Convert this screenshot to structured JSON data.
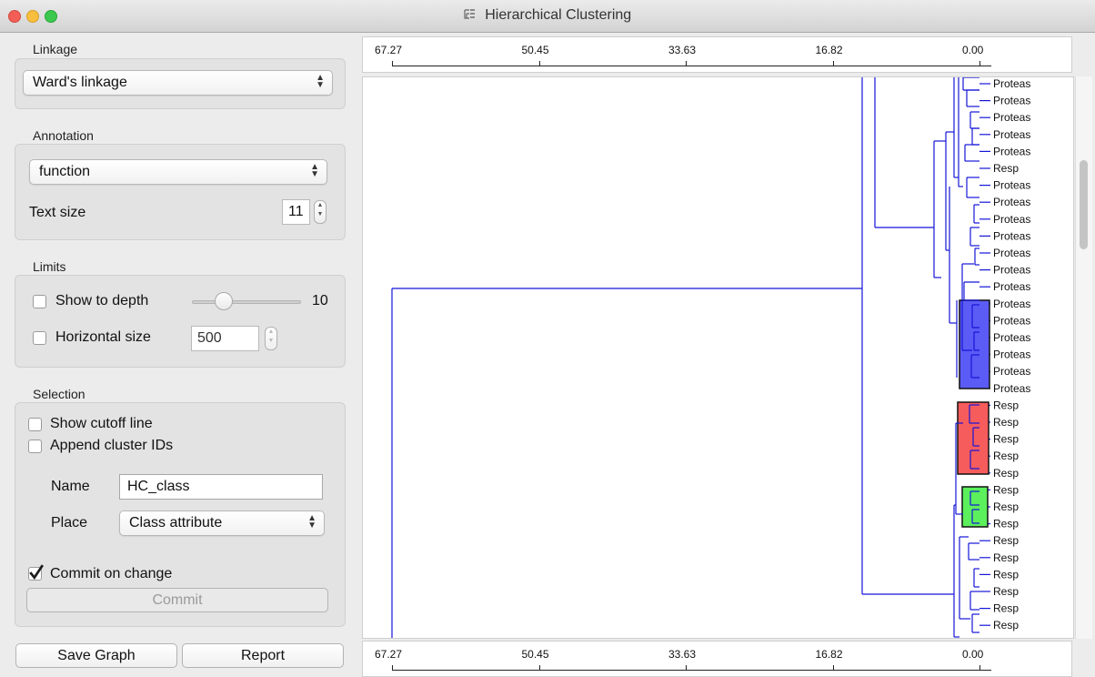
{
  "window": {
    "title": "Hierarchical Clustering"
  },
  "linkage": {
    "title": "Linkage",
    "value": "Ward's linkage"
  },
  "annotation": {
    "title": "Annotation",
    "value": "function",
    "text_size_label": "Text size",
    "text_size_value": "11"
  },
  "limits": {
    "title": "Limits",
    "show_depth_label": "Show to depth",
    "depth_value": "10",
    "depth_fraction": 0.25,
    "horizontal_size_label": "Horizontal size",
    "horizontal_size_value": "500"
  },
  "selection": {
    "title": "Selection",
    "show_cutoff_label": "Show cutoff line",
    "append_ids_label": "Append cluster IDs",
    "name_label": "Name",
    "name_value": "HC_class",
    "place_label": "Place",
    "place_value": "Class attribute",
    "commit_on_change_label": "Commit on change",
    "commit_on_change_checked": true,
    "commit_button": "Commit"
  },
  "footer": {
    "save_graph": "Save Graph",
    "report": "Report"
  },
  "axis": {
    "ticks": [
      "67.27",
      "50.45",
      "33.63",
      "16.82",
      "0.00"
    ]
  },
  "leaves": [
    "Proteas",
    "Proteas",
    "Proteas",
    "Proteas",
    "Proteas",
    "Resp",
    "Proteas",
    "Proteas",
    "Proteas",
    "Proteas",
    "Proteas",
    "Proteas",
    "Proteas",
    "Proteas",
    "Proteas",
    "Proteas",
    "Proteas",
    "Proteas",
    "Proteas",
    "Resp",
    "Resp",
    "Resp",
    "Resp",
    "Resp",
    "Resp",
    "Resp",
    "Resp",
    "Resp",
    "Resp",
    "Resp",
    "Resp",
    "Resp",
    "Resp"
  ],
  "clusters": [
    {
      "color": "#5b5bf5"
    },
    {
      "color": "#f75c5c"
    },
    {
      "color": "#5cf05c"
    }
  ],
  "colors": {
    "tree": "#1515d8"
  }
}
